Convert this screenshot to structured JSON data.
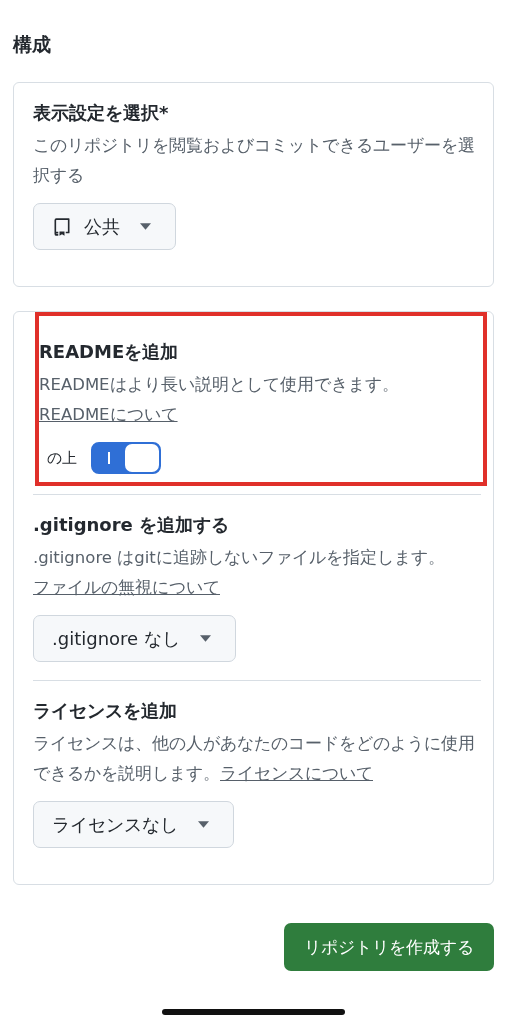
{
  "title": "構成",
  "cards": [
    {
      "sections": [
        {
          "kind": "visibility",
          "heading": "表示設定を選択*",
          "description": "このリポジトリを閲覧およびコミットできるユーザーを選択する",
          "select": {
            "value": "公共"
          }
        }
      ]
    },
    {
      "sections": [
        {
          "kind": "toggle",
          "highlighted": true,
          "heading": "READMEを追加",
          "description": "READMEはより長い説明として使用できます。",
          "link": "READMEについて",
          "toggle": {
            "label": "の上",
            "on": true
          }
        },
        {
          "kind": "select",
          "heading": ".gitignore を追加する",
          "description": ".gitignore はgitに追跡しないファイルを指定します。",
          "link": "ファイルの無視について",
          "select": {
            "value": ".gitignore なし"
          }
        },
        {
          "kind": "select",
          "heading": "ライセンスを追加",
          "description": "ライセンスは、他の人があなたのコードをどのように使用できるかを説明します。",
          "link": "ライセンスについて",
          "select": {
            "value": "ライセンスなし"
          }
        }
      ]
    }
  ],
  "create_button": "リポジトリを作成する"
}
